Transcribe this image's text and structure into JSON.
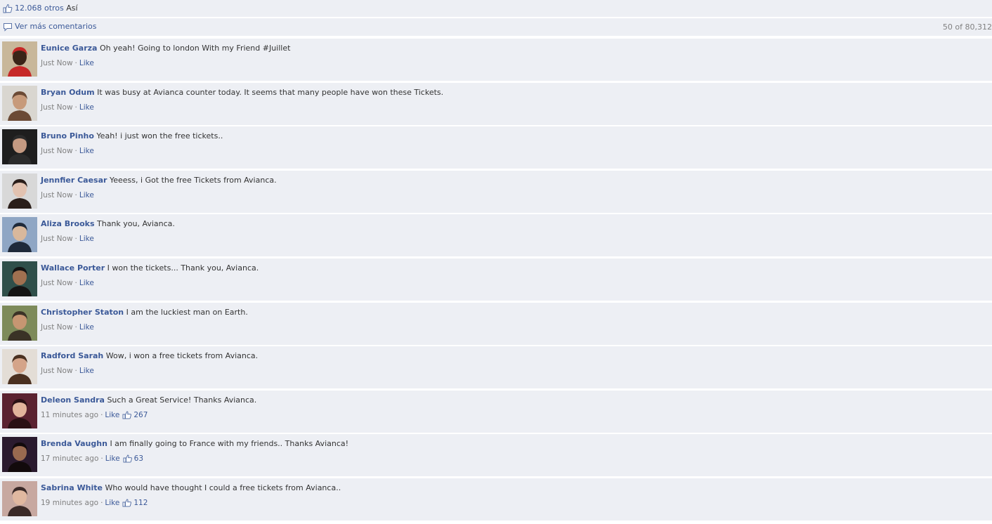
{
  "likes_bar": {
    "count": "12.068 otros",
    "suffix": "Así"
  },
  "more_bar": {
    "label": "Ver más comentarios",
    "count": "50 of 80,312"
  },
  "comments": [
    {
      "author": "Eunice Garza",
      "text": "Oh yeah! Going to london With my Friend #Juillet",
      "time": "Just Now",
      "like": "Like",
      "likes": "",
      "colors": [
        "#c8b79a",
        "#3a2418",
        "#c62828"
      ]
    },
    {
      "author": "Bryan Odum",
      "text": "It was busy at Avianca counter today. It seems that many people have won these Tickets.",
      "time": "Just Now",
      "like": "Like",
      "likes": "",
      "colors": [
        "#d9d6d0",
        "#c79a7a",
        "#6b4a35"
      ]
    },
    {
      "author": "Bruno Pinho",
      "text": "Yeah! i just won the free tickets..",
      "time": "Just Now",
      "like": "Like",
      "likes": "",
      "colors": [
        "#1e1e1e",
        "#c49a82",
        "#2b2b2b"
      ]
    },
    {
      "author": "Jennfier Caesar",
      "text": "Yeeess, i Got the free Tickets from Avianca.",
      "time": "Just Now",
      "like": "Like",
      "likes": "",
      "colors": [
        "#d8d8d8",
        "#e2c2b0",
        "#2a1e1a"
      ]
    },
    {
      "author": "Aliza Brooks",
      "text": "Thank you, Avianca.",
      "time": "Just Now",
      "like": "Like",
      "likes": "",
      "colors": [
        "#8fa6c4",
        "#d8b89c",
        "#1f2a3a"
      ]
    },
    {
      "author": "Wallace Porter",
      "text": "I won the tickets... Thank you, Avianca.",
      "time": "Just Now",
      "like": "Like",
      "likes": "",
      "colors": [
        "#2f4f4a",
        "#a07050",
        "#141414"
      ]
    },
    {
      "author": "Christopher Staton",
      "text": "I am the luckiest man on Earth.",
      "time": "Just Now",
      "like": "Like",
      "likes": "",
      "colors": [
        "#7d8a5a",
        "#c69672",
        "#3a3226"
      ]
    },
    {
      "author": "Radford Sarah",
      "text": "Wow, i won a free tickets from Avianca.",
      "time": "Just Now",
      "like": "Like",
      "likes": "",
      "colors": [
        "#e3ddd6",
        "#d4a489",
        "#4a3020"
      ]
    },
    {
      "author": "Deleon Sandra",
      "text": "Such a Great Service! Thanks Avianca.",
      "time": "11 minutes ago",
      "like": "Like",
      "likes": "267",
      "colors": [
        "#5a2230",
        "#e2b49c",
        "#2a1014"
      ]
    },
    {
      "author": "Brenda Vaughn",
      "text": "I am finally going to France with my friends.. Thanks Avianca!",
      "time": "17 minutec ago",
      "like": "Like",
      "likes": "63",
      "colors": [
        "#2a1a2e",
        "#9a6a50",
        "#120a0c"
      ]
    },
    {
      "author": "Sabrina White",
      "text": "Who would have thought I could a free tickets from Avianca..",
      "time": "19 minutes ago",
      "like": "Like",
      "likes": "112",
      "colors": [
        "#c7a8a0",
        "#e0b8a0",
        "#3a2a28"
      ]
    }
  ]
}
